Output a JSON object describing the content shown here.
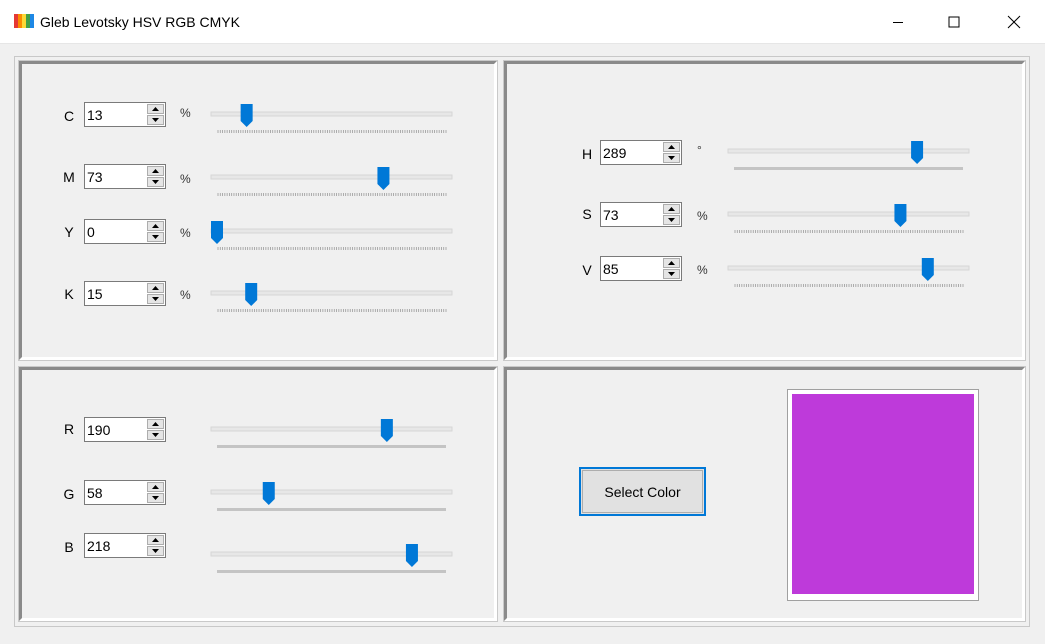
{
  "window": {
    "title": "Gleb Levotsky HSV RGB CMYK",
    "icon": "color-bars-icon"
  },
  "cmyk": {
    "rows": [
      {
        "label": "C",
        "value": "13",
        "unit": "%",
        "fraction": 0.13
      },
      {
        "label": "M",
        "value": "73",
        "unit": "%",
        "fraction": 0.73
      },
      {
        "label": "Y",
        "value": "0",
        "unit": "%",
        "fraction": 0.0
      },
      {
        "label": "K",
        "value": "15",
        "unit": "%",
        "fraction": 0.15
      }
    ]
  },
  "hsv": {
    "rows": [
      {
        "label": "H",
        "value": "289",
        "unit": "°",
        "fraction": 0.803
      },
      {
        "label": "S",
        "value": "73",
        "unit": "%",
        "fraction": 0.73
      },
      {
        "label": "V",
        "value": "85",
        "unit": "%",
        "fraction": 0.85
      }
    ]
  },
  "rgb": {
    "rows": [
      {
        "label": "R",
        "value": "190",
        "fraction": 0.745
      },
      {
        "label": "G",
        "value": "58",
        "fraction": 0.227
      },
      {
        "label": "B",
        "value": "218",
        "fraction": 0.855
      }
    ]
  },
  "actions": {
    "select_color_label": "Select Color"
  },
  "preview": {
    "color": "#be3ada"
  },
  "colors": {
    "accent": "#0078d7"
  }
}
